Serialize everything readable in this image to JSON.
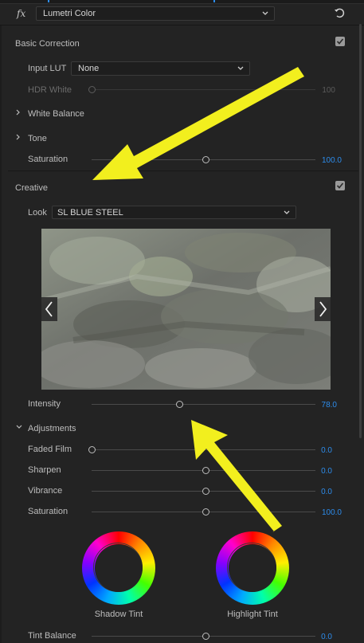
{
  "header": {
    "effect_name": "Lumetri Color"
  },
  "basic_correction": {
    "title": "Basic Correction",
    "input_lut_label": "Input LUT",
    "input_lut_value": "None",
    "hdr_white_label": "HDR White",
    "hdr_white_value": "100",
    "white_balance_label": "White Balance",
    "tone_label": "Tone",
    "saturation_label": "Saturation",
    "saturation_value": "100.0"
  },
  "creative": {
    "title": "Creative",
    "look_label": "Look",
    "look_value": "SL BLUE STEEL",
    "intensity_label": "Intensity",
    "intensity_value": "78.0",
    "adjustments_label": "Adjustments",
    "faded_film_label": "Faded Film",
    "faded_film_value": "0.0",
    "sharpen_label": "Sharpen",
    "sharpen_value": "0.0",
    "vibrance_label": "Vibrance",
    "vibrance_value": "0.0",
    "saturation_label": "Saturation",
    "saturation_value": "100.0",
    "shadow_tint_label": "Shadow Tint",
    "highlight_tint_label": "Highlight Tint",
    "tint_balance_label": "Tint Balance",
    "tint_balance_value": "0.0"
  },
  "slider_levels_percent": {
    "hdr_white": 0,
    "basic_saturation": 50,
    "intensity": 39,
    "faded_film": 0,
    "sharpen": 50,
    "vibrance": 50,
    "creative_saturation": 50,
    "tint_balance": 50
  },
  "colors": {
    "accent_blue": "#2d8ceb",
    "annotation_arrow": "#f2ef1e",
    "panel_bg": "#232323"
  },
  "icons": [
    "fx-icon",
    "chevron-down-icon",
    "reset-icon",
    "checkbox-checked-icon",
    "chevron-right-icon",
    "arrow-left-icon",
    "arrow-right-icon",
    "color-wheel",
    "annotation-arrow"
  ]
}
